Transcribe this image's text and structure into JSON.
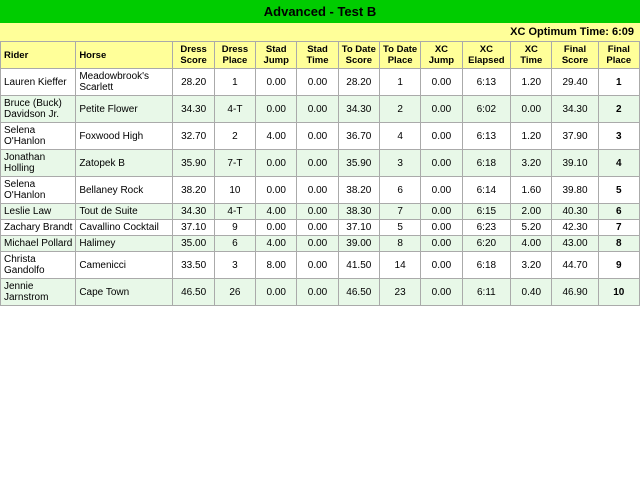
{
  "title": "Advanced - Test B",
  "xc_optimum": "XC Optimum Time: 6:09",
  "headers": {
    "rider": "Rider",
    "horse": "Horse",
    "dress_score": "Dress Score",
    "dress_place": "Dress Place",
    "stad_jump": "Stad Jump",
    "stad_time": "Stad Time",
    "to_date_score": "To Date Score",
    "to_date_place": "To Date Place",
    "xc_jump": "XC Jump",
    "xc_elapsed": "XC Elapsed",
    "xc_time": "XC Time",
    "final_score": "Final Score",
    "final_place": "Final Place"
  },
  "rows": [
    {
      "rider": "Lauren Kieffer",
      "horse": "Meadowbrook's Scarlett",
      "dress_score": "28.20",
      "dress_place": "1",
      "stad_jump": "0.00",
      "stad_time": "0.00",
      "to_date_score": "28.20",
      "to_date_place": "1",
      "xc_jump": "0.00",
      "xc_elapsed": "6:13",
      "xc_time": "1.20",
      "final_score": "29.40",
      "final_place": "1"
    },
    {
      "rider": "Bruce (Buck) Davidson Jr.",
      "horse": "Petite Flower",
      "dress_score": "34.30",
      "dress_place": "4-T",
      "stad_jump": "0.00",
      "stad_time": "0.00",
      "to_date_score": "34.30",
      "to_date_place": "2",
      "xc_jump": "0.00",
      "xc_elapsed": "6:02",
      "xc_time": "0.00",
      "final_score": "34.30",
      "final_place": "2"
    },
    {
      "rider": "Selena O'Hanlon",
      "horse": "Foxwood High",
      "dress_score": "32.70",
      "dress_place": "2",
      "stad_jump": "4.00",
      "stad_time": "0.00",
      "to_date_score": "36.70",
      "to_date_place": "4",
      "xc_jump": "0.00",
      "xc_elapsed": "6:13",
      "xc_time": "1.20",
      "final_score": "37.90",
      "final_place": "3"
    },
    {
      "rider": "Jonathan Holling",
      "horse": "Zatopek B",
      "dress_score": "35.90",
      "dress_place": "7-T",
      "stad_jump": "0.00",
      "stad_time": "0.00",
      "to_date_score": "35.90",
      "to_date_place": "3",
      "xc_jump": "0.00",
      "xc_elapsed": "6:18",
      "xc_time": "3.20",
      "final_score": "39.10",
      "final_place": "4"
    },
    {
      "rider": "Selena O'Hanlon",
      "horse": "Bellaney Rock",
      "dress_score": "38.20",
      "dress_place": "10",
      "stad_jump": "0.00",
      "stad_time": "0.00",
      "to_date_score": "38.20",
      "to_date_place": "6",
      "xc_jump": "0.00",
      "xc_elapsed": "6:14",
      "xc_time": "1.60",
      "final_score": "39.80",
      "final_place": "5"
    },
    {
      "rider": "Leslie Law",
      "horse": "Tout de Suite",
      "dress_score": "34.30",
      "dress_place": "4-T",
      "stad_jump": "4.00",
      "stad_time": "0.00",
      "to_date_score": "38.30",
      "to_date_place": "7",
      "xc_jump": "0.00",
      "xc_elapsed": "6:15",
      "xc_time": "2.00",
      "final_score": "40.30",
      "final_place": "6"
    },
    {
      "rider": "Zachary Brandt",
      "horse": "Cavallino Cocktail",
      "dress_score": "37.10",
      "dress_place": "9",
      "stad_jump": "0.00",
      "stad_time": "0.00",
      "to_date_score": "37.10",
      "to_date_place": "5",
      "xc_jump": "0.00",
      "xc_elapsed": "6:23",
      "xc_time": "5.20",
      "final_score": "42.30",
      "final_place": "7"
    },
    {
      "rider": "Michael Pollard",
      "horse": "Halimey",
      "dress_score": "35.00",
      "dress_place": "6",
      "stad_jump": "4.00",
      "stad_time": "0.00",
      "to_date_score": "39.00",
      "to_date_place": "8",
      "xc_jump": "0.00",
      "xc_elapsed": "6:20",
      "xc_time": "4.00",
      "final_score": "43.00",
      "final_place": "8"
    },
    {
      "rider": "Christa Gandolfo",
      "horse": "Camenicci",
      "dress_score": "33.50",
      "dress_place": "3",
      "stad_jump": "8.00",
      "stad_time": "0.00",
      "to_date_score": "41.50",
      "to_date_place": "14",
      "xc_jump": "0.00",
      "xc_elapsed": "6:18",
      "xc_time": "3.20",
      "final_score": "44.70",
      "final_place": "9"
    },
    {
      "rider": "Jennie Jarnstrom",
      "horse": "Cape Town",
      "dress_score": "46.50",
      "dress_place": "26",
      "stad_jump": "0.00",
      "stad_time": "0.00",
      "to_date_score": "46.50",
      "to_date_place": "23",
      "xc_jump": "0.00",
      "xc_elapsed": "6:11",
      "xc_time": "0.40",
      "final_score": "46.90",
      "final_place": "10"
    }
  ]
}
